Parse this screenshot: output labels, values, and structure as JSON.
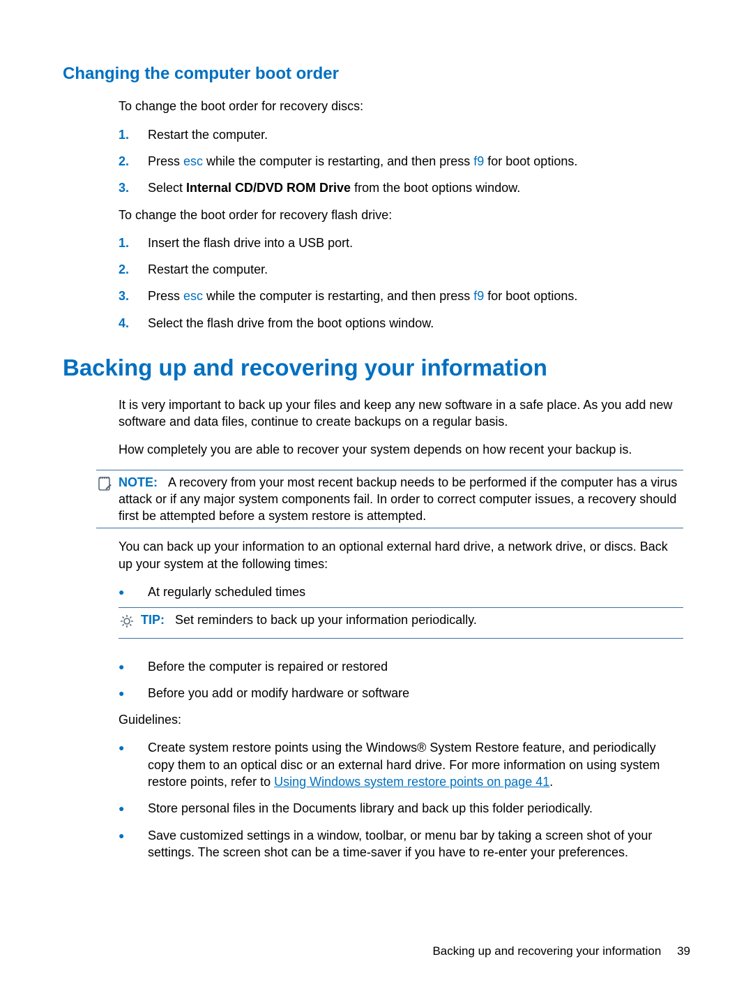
{
  "heading1": "Changing the computer boot order",
  "intro1": "To change the boot order for recovery discs:",
  "list1": [
    {
      "n": "1.",
      "parts": [
        "Restart the computer."
      ]
    },
    {
      "n": "2.",
      "parts": [
        "Press ",
        " while the computer is restarting, and then press ",
        " for boot options."
      ],
      "keys": [
        "esc",
        "f9"
      ]
    },
    {
      "n": "3.",
      "parts": [
        "Select ",
        "Internal CD/DVD ROM Drive",
        " from the boot options window."
      ],
      "bold": true
    }
  ],
  "intro2": "To change the boot order for recovery flash drive:",
  "list2": [
    {
      "n": "1.",
      "parts": [
        "Insert the flash drive into a USB port."
      ]
    },
    {
      "n": "2.",
      "parts": [
        "Restart the computer."
      ]
    },
    {
      "n": "3.",
      "parts": [
        "Press ",
        " while the computer is restarting, and then press ",
        " for boot options."
      ],
      "keys": [
        "esc",
        "f9"
      ]
    },
    {
      "n": "4.",
      "parts": [
        "Select the flash drive from the boot options window."
      ]
    }
  ],
  "heading2": "Backing up and recovering your information",
  "para1": "It is very important to back up your files and keep any new software in a safe place. As you add new software and data files, continue to create backups on a regular basis.",
  "para2": "How completely you are able to recover your system depends on how recent your backup is.",
  "note_label": "NOTE:",
  "note_body": "A recovery from your most recent backup needs to be performed if the computer has a virus attack or if any major system components fail. In order to correct computer issues, a recovery should first be attempted before a system restore is attempted.",
  "para3": "You can back up your information to an optional external hard drive, a network drive, or discs. Back up your system at the following times:",
  "times": [
    "At regularly scheduled times",
    "Before the computer is repaired or restored",
    "Before you add or modify hardware or software"
  ],
  "tip_label": "TIP:",
  "tip_body": "Set reminders to back up your information periodically.",
  "guidelines_label": "Guidelines:",
  "guidelines": [
    {
      "pre": "Create system restore points using the Windows® System Restore feature, and periodically copy them to an optical disc or an external hard drive. For more information on using system restore points, refer to ",
      "link": "Using Windows system restore points on page 41",
      "post": "."
    },
    {
      "pre": "Store personal files in the Documents library and back up this folder periodically."
    },
    {
      "pre": "Save customized settings in a window, toolbar, or menu bar by taking a screen shot of your settings. The screen shot can be a time-saver if you have to re-enter your preferences."
    }
  ],
  "footer_title": "Backing up and recovering your information",
  "footer_page": "39"
}
